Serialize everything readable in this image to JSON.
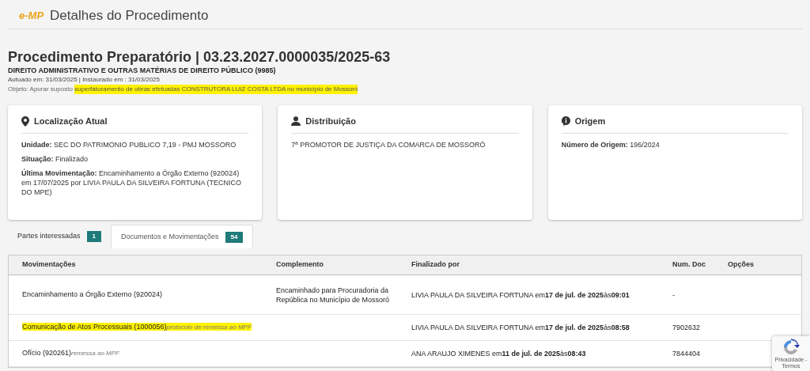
{
  "header": {
    "logo": "e-MP",
    "title": "Detalhes do Procedimento"
  },
  "procedure": {
    "title": "Procedimento Preparatório | 03.23.2027.0000035/2025-63",
    "subject": "DIREITO ADMINISTRATIVO E OUTRAS MATÉRIAS DE DIREITO PÚBLICO (9985)",
    "dates": "Autuado em: 31/03/2025 | Instaurado em : 31/03/2025",
    "object_label": "Objeto: Apurar suposto ",
    "object_text": "superfaturamento de obras efetuadas CONSTRUTORA LUIZ COSTA LTDA no município de Mossoró",
    "object_highlighted": true
  },
  "cards": [
    {
      "kind": "location",
      "title": "Localização Atual",
      "lines": [
        "**Unidade:** SEC DO PATRIMONIO PUBLICO 7,19 - PMJ MOSSORO",
        "**Situação:** Finalizado",
        "**Última Movimentação:** Encaminhamento a Órgão Externo (920024) em 17/07/2025 por LIVIA PAULA DA SILVEIRA FORTUNA (TECNICO DO MPE)"
      ]
    },
    {
      "kind": "person",
      "title": "Distribuição",
      "lines": [
        "7ª PROMOTOR DE JUSTIÇA DA COMARCA DE MOSSORÓ"
      ]
    },
    {
      "kind": "info",
      "title": "Origem",
      "lines": [
        "**Número de Origem:** 196/2024"
      ]
    }
  ],
  "tabs": [
    {
      "label": "Partes interessadas",
      "count": "1",
      "selected": false
    },
    {
      "label": "Documentos e Movimentações",
      "count": "54",
      "selected": true
    }
  ],
  "table": {
    "columns": [
      "Movimentações",
      "Complemento",
      "Finalizado por",
      "Num. Doc",
      "Opções"
    ],
    "rows": [
      {
        "movement": "Encaminhamento a Órgão Externo (920024)",
        "note": "",
        "highlighted": false,
        "complement": "Encaminhado para Procuradoria da República no Município de Mossoró",
        "finished_by": "LIVIA PAULA DA SILVEIRA FORTUNA em**17 de jul. de 2025**às**09:01**",
        "doc": "-"
      },
      {
        "movement": "Comunicação de Atos Processuais (1000056)",
        "note": "protocolo de remessa ao MPF",
        "highlighted": true,
        "complement": "",
        "finished_by": "LIVIA PAULA DA SILVEIRA FORTUNA em**17 de jul. de 2025**às**08:58**",
        "doc": "7902632"
      },
      {
        "movement": "Ofício (920261)",
        "note": "remessa ao MPF",
        "highlighted": false,
        "complement": "",
        "finished_by": "ANA ARAUJO XIMENES em**11 de jul. de 2025**às**08:43**",
        "doc": "7844404"
      }
    ]
  },
  "recaptcha": {
    "links": "Privacidade - Termos"
  }
}
